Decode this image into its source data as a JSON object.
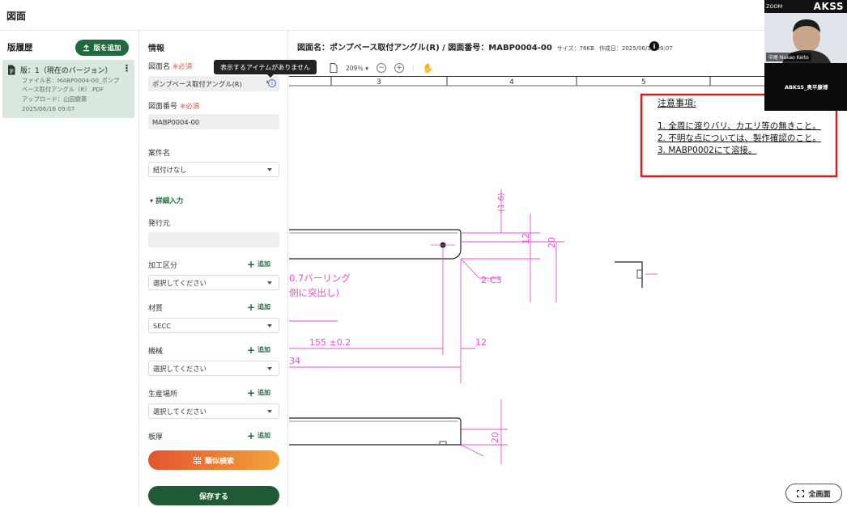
{
  "app": {
    "title": "図面"
  },
  "versions": {
    "title": "版履歴",
    "add_button": "版を追加",
    "current": {
      "name": "版：1（現在のバージョン）",
      "file_line1": "ファイル名：MABP0004-00_ポンプ",
      "file_line2": "ベース取付アングル（R）.PDF",
      "uploader": "アップロード：山田樹斎",
      "date": "2025/06/16 09:07"
    }
  },
  "info": {
    "title": "情報",
    "required_mark": "※必須",
    "drawing_name": {
      "label": "図面名",
      "value": "ポンプベース取付アングル(R)"
    },
    "tooltip": "表示するアイテムがありません",
    "drawing_number": {
      "label": "図面番号",
      "value": "MABP0004-00"
    },
    "project": {
      "label": "案件名",
      "value": "紐付けなし"
    },
    "detail_toggle": "詳細入力",
    "issuer": {
      "label": "発行元",
      "value": ""
    },
    "processing": {
      "label": "加工区分",
      "value": "選択してください"
    },
    "material": {
      "label": "材質",
      "value": "SECC"
    },
    "machine": {
      "label": "機械",
      "value": "選択してください"
    },
    "production_site": {
      "label": "生産場所",
      "value": "選択してください"
    },
    "thickness": {
      "label": "板厚"
    },
    "add_label": "追加",
    "similar_button": "類似検索",
    "save_button": "保存する"
  },
  "viewer": {
    "header": "図面名：ポンプベース取付アングル(R)  /  図面番号：MABP0004-00",
    "size": "サイズ：76KB",
    "created": "作成日：2025/06/16 09:07",
    "zoom": "209％",
    "fullscreen_button": "全画面",
    "drawing": {
      "col_labels": [
        "3",
        "4",
        "5"
      ],
      "notes_title": "注意事項:",
      "notes": [
        "1. 全周に渡りバリ、カエリ等の無きこと。",
        "2. 不明な点については、製作確認のこと。",
        "3. MABP0002にて溶接。"
      ],
      "dim_1_6": "(1.6)",
      "dim_12": "12",
      "dim_20": "20",
      "dim_c3": "2-C3",
      "dim_155": "155 ±0.2",
      "dim_12b": "12",
      "dim_34": "34",
      "dim_20b": "20",
      "burring_1": "0.7バーリング",
      "burring_2": "側に突出し)"
    }
  },
  "zoom_overlay": {
    "label": "ZOOM",
    "brand": "AKSS",
    "participant_1": "中尾 Nakao Keito",
    "participant_2": "ABKSS_奥平康博"
  },
  "colors": {
    "accent": "#1f6b3e",
    "required": "#e5533d",
    "dimension": "#e84fd6",
    "highlight": "#d11f1f"
  }
}
